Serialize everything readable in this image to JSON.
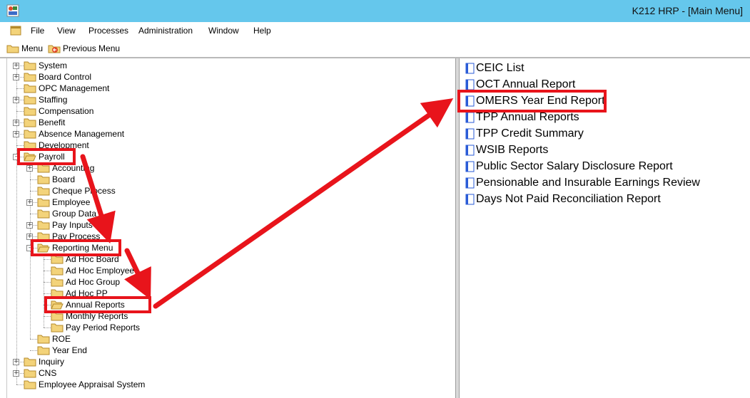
{
  "window": {
    "title": "K212 HRP - [Main Menu]"
  },
  "menubar": {
    "items": [
      "File",
      "View",
      "Processes",
      "Administration",
      "Window",
      "Help"
    ]
  },
  "toolbar": {
    "menu_label": "Menu",
    "previous_menu_label": "Previous Menu"
  },
  "tree": {
    "system": "System",
    "board_control": "Board Control",
    "opc_management": "OPC Management",
    "staffing": "Staffing",
    "compensation": "Compensation",
    "benefit": "Benefit",
    "absence_management": "Absence Management",
    "development": "Development",
    "payroll": "Payroll",
    "accounting": "Accounting",
    "board": "Board",
    "cheque_process": "Cheque Process",
    "employee": "Employee",
    "group_data": "Group Data",
    "pay_inputs": "Pay Inputs",
    "pay_process": "Pay Process",
    "reporting_menu": "Reporting Menu",
    "ad_hoc_board": "Ad Hoc Board",
    "ad_hoc_employee": "Ad Hoc Employee",
    "ad_hoc_group": "Ad Hoc Group",
    "ad_hoc_pp": "Ad Hoc PP",
    "annual_reports": "Annual Reports",
    "monthly_reports": "Monthly Reports",
    "pay_period_reports": "Pay Period Reports",
    "roe": "ROE",
    "year_end": "Year End",
    "inquiry": "Inquiry",
    "cns": "CNS",
    "employee_appraisal_system": "Employee Appraisal System"
  },
  "reports": {
    "items": [
      "CEIC List",
      "OCT Annual Report",
      "OMERS Year End Report",
      "TPP Annual Reports",
      "TPP Credit Summary",
      "WSIB Reports",
      "Public Sector Salary Disclosure Report",
      "Pensionable and Insurable Earnings Review",
      "Days Not Paid Reconciliation Report"
    ]
  },
  "colors": {
    "titlebar": "#65c7ec",
    "highlight_red": "#e8141b",
    "folder_yellow": "#f3d37a",
    "folder_edge": "#b58a2b"
  }
}
